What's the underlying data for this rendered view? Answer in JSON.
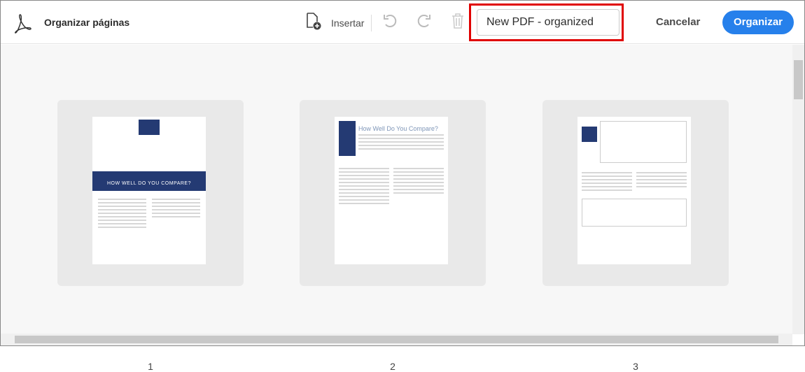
{
  "header": {
    "title": "Organizar páginas",
    "insert_label": "Insertar",
    "filename": "New PDF - organized",
    "cancel_label": "Cancelar",
    "organize_label": "Organizar"
  },
  "pages": [
    {
      "number": "1",
      "heading": "HOW WELL DO YOU COMPARE?"
    },
    {
      "number": "2",
      "heading": "How Well Do You Compare?"
    },
    {
      "number": "3",
      "heading": ""
    }
  ],
  "colors": {
    "accent": "#2680eb",
    "highlight": "#e00000",
    "brand_navy": "#243a73"
  }
}
